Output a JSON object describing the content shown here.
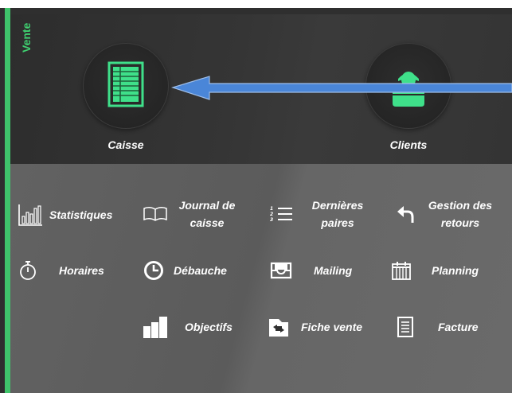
{
  "section": {
    "title": "Vente"
  },
  "top_tiles": [
    {
      "label": "Caisse",
      "icon": "cash-register-sheet-icon"
    },
    {
      "label": "Clients",
      "icon": "user-icon"
    }
  ],
  "menu": {
    "statistiques": "Statistiques",
    "journal_line1": "Journal de",
    "journal_line2": "caisse",
    "dernieres_line1": "Dernières",
    "dernieres_line2": "paires",
    "retours_line1": "Gestion des",
    "retours_line2": "retours",
    "horaires": "Horaires",
    "debauche": "Débauche",
    "mailing": "Mailing",
    "planning": "Planning",
    "objectifs": "Objectifs",
    "fiche_vente": "Fiche vente",
    "facture": "Facture"
  },
  "colors": {
    "accent": "#3fc46b",
    "arrow": "#4a86d8"
  }
}
